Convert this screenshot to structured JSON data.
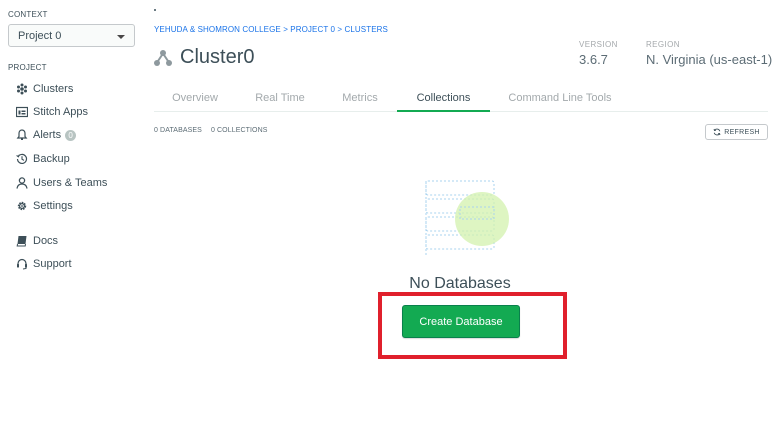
{
  "sidebar": {
    "context_label": "CONTEXT",
    "project_select_value": "Project 0",
    "project_label": "PROJECT",
    "items": [
      {
        "label": "Clusters",
        "icon": "clusters-icon"
      },
      {
        "label": "Stitch Apps",
        "icon": "stitch-icon"
      },
      {
        "label": "Alerts",
        "icon": "bell-icon",
        "badge": "0"
      },
      {
        "label": "Backup",
        "icon": "backup-clock-icon"
      },
      {
        "label": "Users & Teams",
        "icon": "user-icon"
      },
      {
        "label": "Settings",
        "icon": "gear-icon"
      },
      {
        "label": "Docs",
        "icon": "book-icon"
      },
      {
        "label": "Support",
        "icon": "headset-icon"
      }
    ]
  },
  "header": {
    "breadcrumb": "YEHUDA & SHOMRON COLLEGE > PROJECT 0 > CLUSTERS",
    "title": "Cluster0",
    "version_label": "VERSION",
    "version_value": "3.6.7",
    "region_label": "REGION",
    "region_value": "N. Virginia (us-east-1)"
  },
  "tabs": [
    {
      "label": "Overview",
      "active": false
    },
    {
      "label": "Real Time",
      "active": false
    },
    {
      "label": "Metrics",
      "active": false
    },
    {
      "label": "Collections",
      "active": true
    },
    {
      "label": "Command Line Tools",
      "active": false
    }
  ],
  "collections": {
    "databases_count": "0 DATABASES",
    "collections_count": "0 COLLECTIONS",
    "refresh_label": "REFRESH",
    "empty_state": "No Databases",
    "create_button": "Create Database"
  },
  "colors": {
    "accent_green": "#13aa52",
    "highlight_red": "#e0202c",
    "text": "#3d4f58"
  }
}
